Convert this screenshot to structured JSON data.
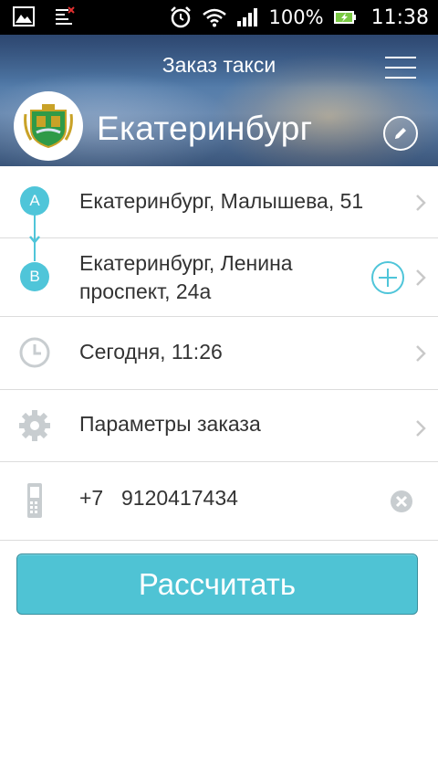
{
  "status_bar": {
    "battery_percent": "100%",
    "time": "11:38",
    "icons": [
      "gallery-icon",
      "no-signal-icon",
      "alarm-clock-icon",
      "wifi-icon",
      "cell-signal-icon",
      "battery-charging-icon"
    ]
  },
  "header": {
    "title": "Заказ такси",
    "city": "Екатеринбург",
    "icons": [
      "menu-icon",
      "city-emblem",
      "edit-icon"
    ]
  },
  "route": {
    "from": {
      "marker": "A",
      "address": "Екатеринбург, Малышева, 51"
    },
    "to": {
      "marker": "B",
      "address_line1": "Екатеринбург, Ленина",
      "address_line2": "проспект, 24а"
    }
  },
  "time_row": {
    "label": "Сегодня, 11:26"
  },
  "params_row": {
    "label": "Параметры заказа"
  },
  "phone_row": {
    "prefix": "+7",
    "number": "9120417434"
  },
  "calculate_button": {
    "label": "Рассчитать"
  },
  "colors": {
    "accent": "#4fc5d9",
    "button": "#4fc3d4",
    "text": "#333333",
    "icon_gray": "#c8cdd0"
  }
}
